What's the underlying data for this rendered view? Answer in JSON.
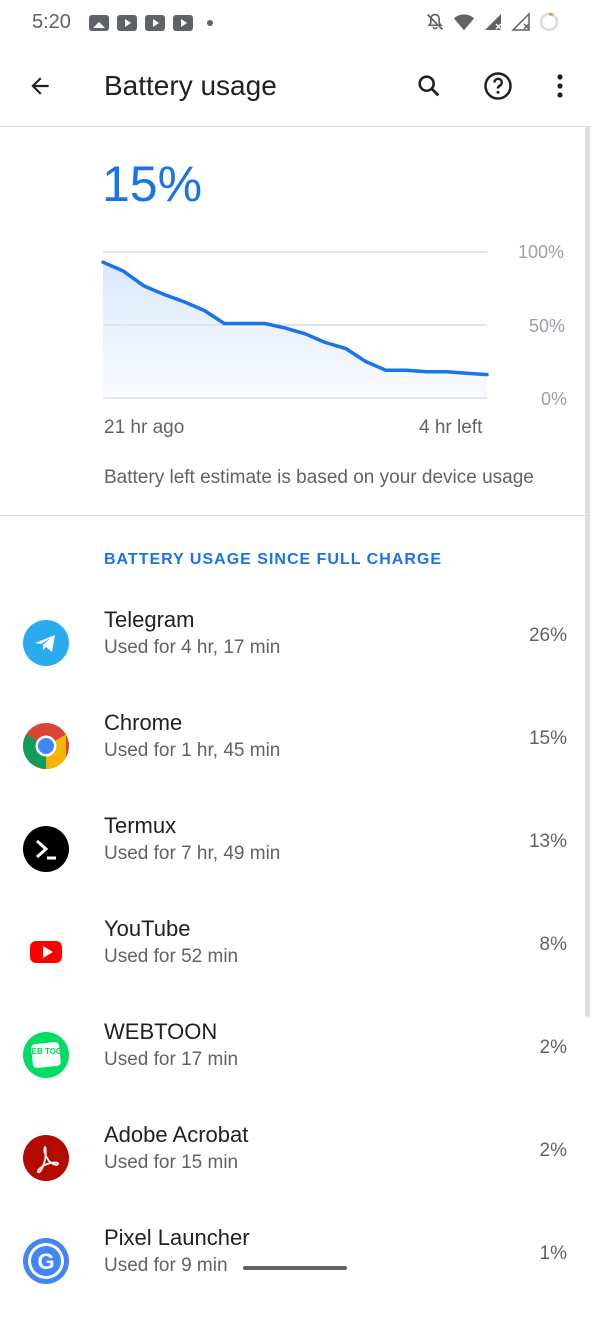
{
  "status_bar": {
    "time": "5:20"
  },
  "app_bar": {
    "title": "Battery usage"
  },
  "battery": {
    "percent": "15%",
    "chart_data": {
      "type": "area",
      "y_labels": [
        "100%",
        "50%",
        "0%"
      ],
      "x_labels": [
        "21 hr ago",
        "4 hr left"
      ],
      "ylim": [
        0,
        100
      ],
      "series": [
        {
          "values": [
            93,
            87,
            77,
            71,
            66,
            60,
            51,
            51,
            51,
            48,
            44,
            38,
            34,
            25,
            19,
            19,
            18,
            18,
            17,
            16
          ]
        }
      ]
    },
    "estimate": "Battery left estimate is based on your device usage"
  },
  "section_header": "BATTERY USAGE SINCE FULL CHARGE",
  "apps": [
    {
      "name": "Telegram",
      "usage": "Used for 4 hr, 17 min",
      "percent": "26%",
      "icon": "telegram-icon",
      "color": "#2AABEE"
    },
    {
      "name": "Chrome",
      "usage": "Used for 1 hr, 45 min",
      "percent": "15%",
      "icon": "chrome-icon",
      "color": "#4285F4"
    },
    {
      "name": "Termux",
      "usage": "Used for 7 hr, 49 min",
      "percent": "13%",
      "icon": "termux-icon",
      "color": "#000000"
    },
    {
      "name": "YouTube",
      "usage": "Used for 52 min",
      "percent": "8%",
      "icon": "youtube-icon",
      "color": "#FF0000"
    },
    {
      "name": "WEBTOON",
      "usage": "Used for 17 min",
      "percent": "2%",
      "icon": "webtoon-icon",
      "color": "#00DC64",
      "icon_text": "WEB TOON"
    },
    {
      "name": "Adobe Acrobat",
      "usage": "Used for 15 min",
      "percent": "2%",
      "icon": "acrobat-icon",
      "color": "#B30B00"
    },
    {
      "name": "Pixel Launcher",
      "usage": "Used for 9 min",
      "percent": "1%",
      "icon": "pixel-launcher-icon",
      "color": "#4285F4",
      "icon_text": "G"
    }
  ],
  "colors": {
    "accent": "#1a73e8"
  }
}
